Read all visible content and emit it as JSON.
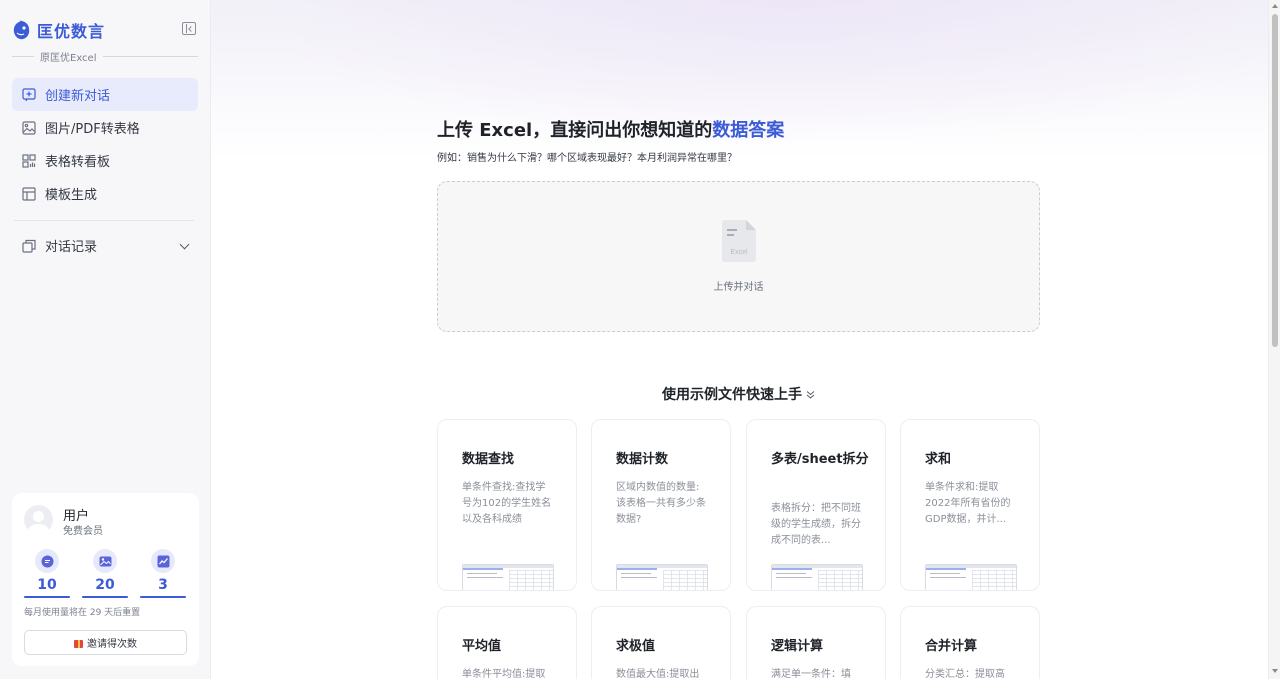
{
  "brand": {
    "name": "匡优数言",
    "subtitle": "原匡优Excel"
  },
  "sidebar": {
    "nav": [
      {
        "label": "创建新对话",
        "icon": "new-chat-icon",
        "active": true
      },
      {
        "label": "图片/PDF转表格",
        "icon": "image-convert-icon",
        "active": false
      },
      {
        "label": "表格转看板",
        "icon": "dashboard-icon",
        "active": false
      },
      {
        "label": "模板生成",
        "icon": "template-icon",
        "active": false
      }
    ],
    "history_label": "对话记录"
  },
  "user": {
    "name": "用户",
    "tier": "免费会员",
    "stats": [
      {
        "icon": "chat-credit-icon",
        "value": "10"
      },
      {
        "icon": "image-credit-icon",
        "value": "20"
      },
      {
        "icon": "chart-credit-icon",
        "value": "3"
      }
    ],
    "reset_note": "每月使用量将在 29 天后重置",
    "invite_label": "邀请得次数"
  },
  "main": {
    "headline_prefix": "上传 Excel，直接问出你想知道的",
    "headline_accent": "数据答案",
    "subline": "例如：销售为什么下滑？哪个区域表现最好？本月利润异常在哪里？",
    "upload": {
      "file_label": "Excel",
      "action_label": "上传并对话"
    },
    "examples_title": "使用示例文件快速上手",
    "examples": [
      {
        "title": "数据查找",
        "desc": "单条件查找:查找学号为102的学生姓名以及各科成绩"
      },
      {
        "title": "数据计数",
        "desc": "区域内数值的数量:该表格一共有多少条数据?"
      },
      {
        "title": "多表/sheet拆分",
        "desc": "表格拆分：把不同班级的学生成绩，拆分成不同的表..."
      },
      {
        "title": "求和",
        "desc": "单条件求和:提取2022年所有省份的GDP数据，并计..."
      },
      {
        "title": "平均值",
        "desc": "单条件平均值:提取"
      },
      {
        "title": "求极值",
        "desc": "数值最大值:提取出"
      },
      {
        "title": "逻辑计算",
        "desc": "满足单一条件：填"
      },
      {
        "title": "合并计算",
        "desc": "分类汇总：提取高"
      }
    ]
  },
  "colors": {
    "accent": "#3c5bd6",
    "sidebar_bg": "#f7f7f9",
    "active_bg": "#e8ebfb"
  }
}
